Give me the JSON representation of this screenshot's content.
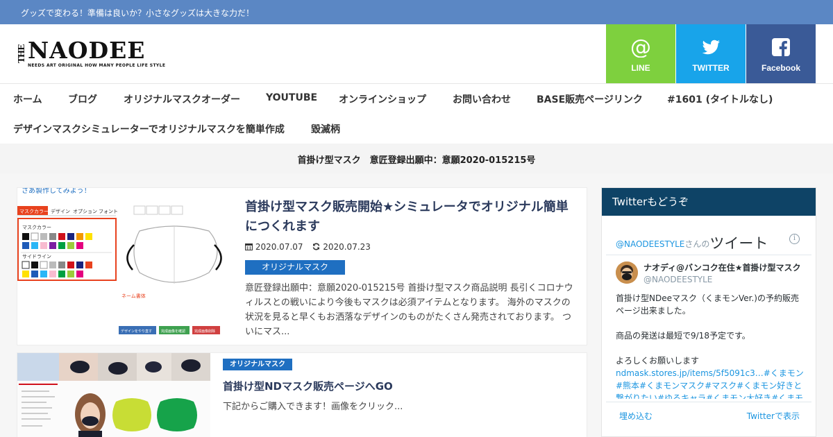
{
  "site": {
    "tagline": "グッズで変わる！準備は良いか？小さなグッズは大きな力だ！",
    "logo_the": "THE",
    "logo_main": "NAODEE",
    "logo_tag": "NEEDS ART ORIGINAL HOW MANY PEOPLE LIFE STYLE"
  },
  "social": [
    {
      "label": "LINE",
      "icon": "at-icon",
      "color": "#7ed03e"
    },
    {
      "label": "TWITTER",
      "icon": "twitter-bird-icon",
      "color": "#18a4ea"
    },
    {
      "label": "Facebook",
      "icon": "facebook-icon",
      "color": "#3a5a97"
    }
  ],
  "nav": [
    "ホーム",
    "ブログ",
    "オリジナルマスクオーダー",
    "YOUTUBE",
    "オンラインショップ",
    "お問い合わせ",
    "BASE販売ページリンク",
    "#1601 (タイトルなし)",
    "デザインマスクシミュレーターでオリジナルマスクを簡単作成",
    "毀滅柄"
  ],
  "notice": "首掛け型マスク　意匠登録出願中：意願2020-015215号",
  "articles": [
    {
      "title": "首掛け型マスク販売開始★シミュレータでオリジナル簡単につくれます",
      "published": "2020.07.07",
      "updated": "2020.07.23",
      "category": "オリジナルマスク",
      "excerpt": "意匠登録出願中：意願2020-015215号 首掛け型マスク商品説明 長引くコロナウィルスとの戦いにより今後もマスクは必須アイテムとなります。 海外のマスクの状況を見ると早くもお洒落なデザインのものがたくさん発売されております。 ついにマス...",
      "thumb": {
        "heading": "さあ製作してみよう！",
        "tabs": [
          "マスクカラー",
          "デザイン",
          "オプション",
          "フォント"
        ],
        "section1": "マスクカラー",
        "section2": "サイドライン",
        "name_label": "ネーム書体",
        "buttons": [
          "デザインをやり直す",
          "完成画像を確認",
          "完成画像削除"
        ]
      }
    },
    {
      "category": "オリジナルマスク",
      "title": "首掛け型NDマスク販売ページへGO",
      "excerpt": "下記からご購入できます！画像をクリック..."
    }
  ],
  "sidebar": {
    "heading": "Twitterもどうぞ",
    "twitter": {
      "account_link": "@NAODEESTYLE",
      "account_suffix": "さんの",
      "tweets_label": "ツイート",
      "info_icon": "i",
      "user_name": "ナオディ@バンコク在住★首掛け型マスク",
      "user_handle": "@NAODEESTYLE",
      "text_lines": [
        "首掛け型NDeeマスク（くまモンVer.)の予約販売ページ出来ました。",
        "",
        "商品の発送は最短で9/18予定です。",
        "",
        "よろしくお願いします"
      ],
      "text_link": "ndmask.stores.jp/items/5f5091c3…#くまモン#熊本#くまモンマスク#マスク#くまモン好きと繋がりたい#ゆるキャラ#くまモン大好き#くまモンか",
      "embed_label": "埋め込む",
      "view_label": "Twitterで表示"
    }
  },
  "colors": {
    "topbar": "#5b87c4",
    "line": "#7ed03e",
    "twitter": "#18a4ea",
    "facebook": "#3a5a97",
    "category": "#1f6fc1",
    "sidebar_head": "#0e4366",
    "link": "#1b95e0"
  }
}
